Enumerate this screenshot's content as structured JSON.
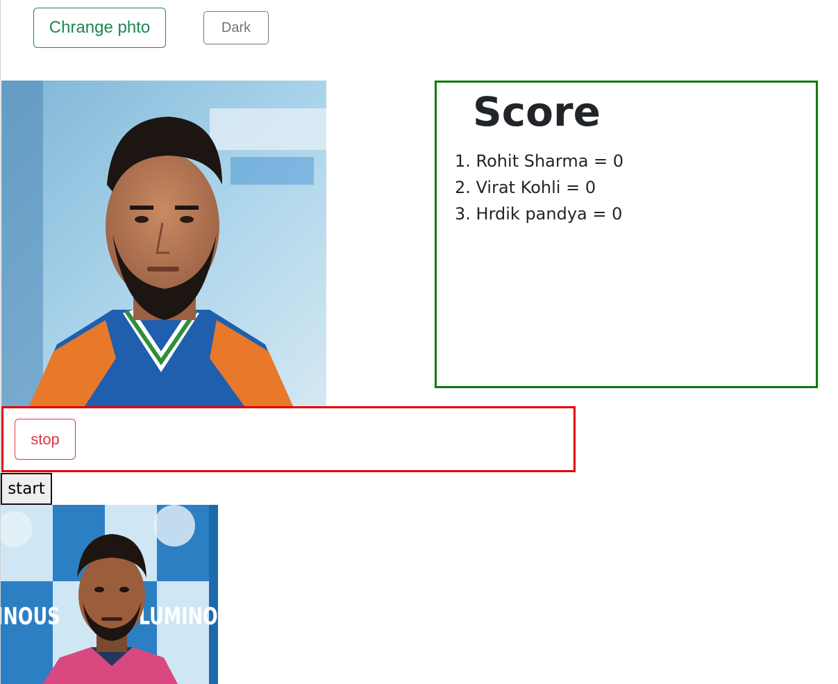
{
  "toolbar": {
    "change_photo_label": "Chrange phto",
    "dark_label": "Dark"
  },
  "score": {
    "title": "Score",
    "items": [
      "1. Rohit Sharma = 0",
      "2. Virat Kohli = 0",
      "3. Hrdik pandya = 0"
    ]
  },
  "controls": {
    "stop_label": "stop",
    "start_label": "start"
  },
  "photo2_logo_text": "LUMINOUS",
  "colors": {
    "success": "#198754",
    "secondary": "#6c757d",
    "danger": "#dc3545",
    "score_border": "#0b7a0b",
    "stop_border": "#e00000"
  }
}
